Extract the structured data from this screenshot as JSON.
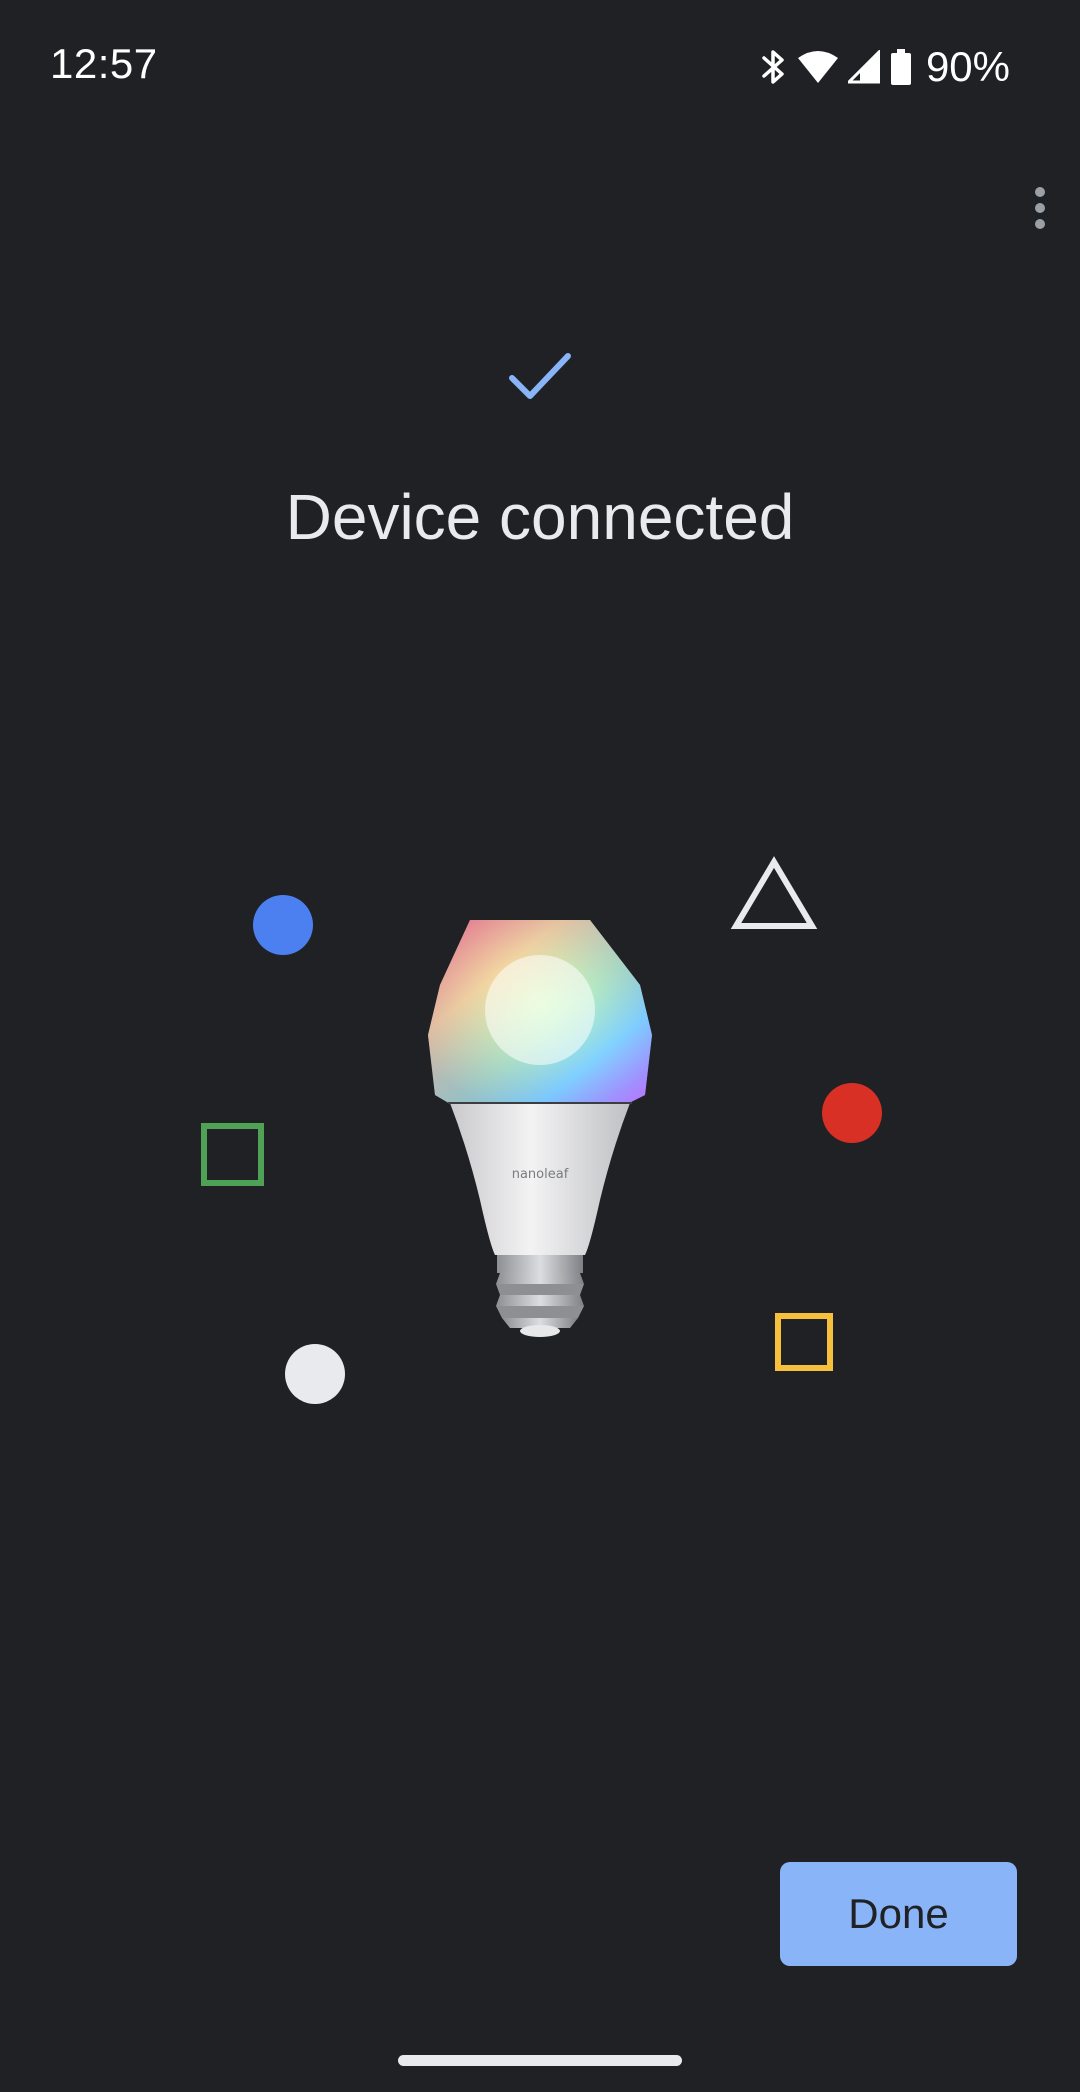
{
  "status_bar": {
    "time": "12:57",
    "battery_percent": "90%",
    "icons": [
      "bluetooth-icon",
      "wifi-icon",
      "cell-signal-icon",
      "battery-icon"
    ]
  },
  "header": {
    "overflow_icon": "more-vert-icon"
  },
  "main": {
    "status_icon": "check-icon",
    "title": "Device connected",
    "illustration": {
      "device": "smart-bulb",
      "brand_mark": "nanoleaf",
      "shapes": [
        {
          "name": "blue-circle",
          "color": "#4c7ff0"
        },
        {
          "name": "white-triangle",
          "color": "#e8eaed"
        },
        {
          "name": "red-circle",
          "color": "#d93025"
        },
        {
          "name": "green-square",
          "color": "#4fa156"
        },
        {
          "name": "yellow-square",
          "color": "#f6bf3c"
        },
        {
          "name": "white-circle",
          "color": "#e8eaed"
        }
      ]
    }
  },
  "footer": {
    "done_label": "Done"
  },
  "colors": {
    "background": "#202124",
    "accent": "#8ab4f8",
    "text": "#e8eaed"
  }
}
